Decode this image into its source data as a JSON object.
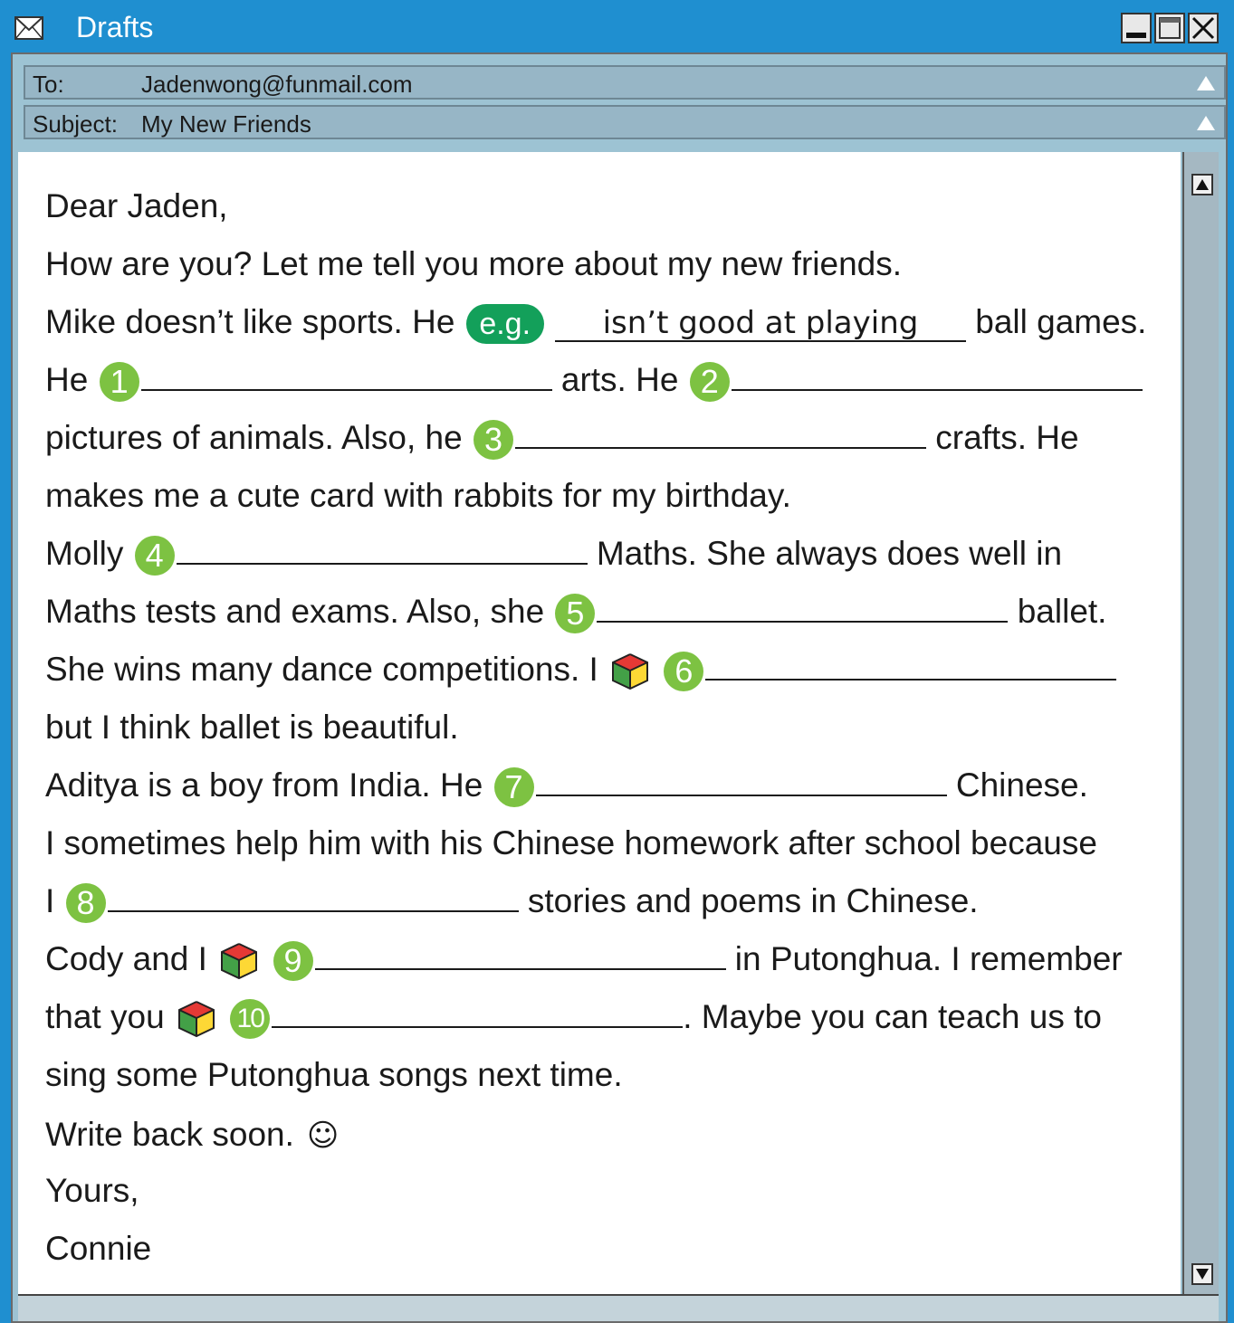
{
  "window": {
    "title": "Drafts"
  },
  "header": {
    "to_label": "To:",
    "to_value": "Jadenwong@funmail.com",
    "subject_label": "Subject:",
    "subject_value": "My New Friends"
  },
  "letter": {
    "greeting": "Dear Jaden,",
    "intro": "How are you? Let me tell you more about my new friends.",
    "l3_pre": "Mike doesn’t like sports. He",
    "eg_badge": "e.g.",
    "eg_answer": "isn’t good at playing",
    "l3_post": "ball games.",
    "l4_a": "He",
    "l4_b": "arts. He",
    "l5_a": "pictures of animals. Also, he",
    "l5_b": "crafts. He",
    "l6": "makes me a cute card with rabbits for my birthday.",
    "l7_a": "Molly",
    "l7_b": "Maths. She always does well in",
    "l8_a": "Maths tests and exams. Also, she",
    "l8_b": "ballet.",
    "l9_a": "She wins many dance competitions. I",
    "l10": "but I think ballet is beautiful.",
    "l11_a": "Aditya is a boy from India. He",
    "l11_b": "Chinese.",
    "l12": "I sometimes help him with his Chinese homework after school because",
    "l13_a": "I",
    "l13_b": "stories and poems in Chinese.",
    "l14_a": "Cody and I",
    "l14_b": "in Putonghua. I remember",
    "l15_a": "that you",
    "l15_b": ". Maybe you can teach us to",
    "l16": "sing some Putonghua songs next time.",
    "l17": "Write back soon.",
    "smiley": "☺",
    "closing": "Yours,",
    "signature": "Connie"
  },
  "numbers": [
    "1",
    "2",
    "3",
    "4",
    "5",
    "6",
    "7",
    "8",
    "9",
    "10"
  ],
  "icons": {
    "title": "envelope-icon",
    "cube": "rubiks-cube-icon"
  },
  "colors": {
    "titlebar": "#1f8fd0",
    "header": "#97b6c6",
    "number_badge": "#7dc242",
    "eg_badge": "#13a05a"
  }
}
